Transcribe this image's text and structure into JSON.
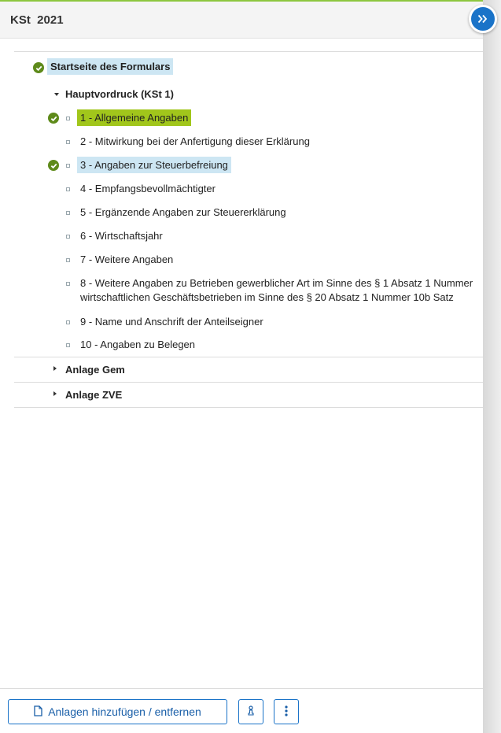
{
  "header": {
    "title": "KSt  2021"
  },
  "tree": {
    "root": {
      "label": "Startseite des Formulars",
      "done": true
    },
    "groups": [
      {
        "label": "Hauptvordruck (KSt 1)",
        "expanded": true,
        "items": [
          {
            "label": "1 - Allgemeine Angaben",
            "done": true,
            "highlight": "active"
          },
          {
            "label": "2 - Mitwirkung bei der Anfertigung dieser Erklärung",
            "done": false
          },
          {
            "label": "3 - Angaben zur Steuerbefreiung",
            "done": true,
            "highlight": "selected"
          },
          {
            "label": "4 - Empfangsbevollmächtigter",
            "done": false
          },
          {
            "label": "5 - Ergänzende Angaben zur Steuererklärung",
            "done": false
          },
          {
            "label": "6 - Wirtschaftsjahr",
            "done": false
          },
          {
            "label": "7 - Weitere Angaben",
            "done": false
          },
          {
            "label_line1": "8 - Weitere Angaben zu Betrieben gewerblicher Art im Sinne des § 1 Absatz 1 Nummer",
            "label_line2": "wirtschaftlichen Geschäftsbetrieben im Sinne des § 20 Absatz 1 Nummer 10b Satz",
            "done": false
          },
          {
            "label": "9 - Name und Anschrift der Anteilseigner",
            "done": false
          },
          {
            "label": "10 - Angaben zu Belegen",
            "done": false
          }
        ]
      },
      {
        "label": "Anlage Gem",
        "expanded": false
      },
      {
        "label": "Anlage ZVE",
        "expanded": false
      }
    ]
  },
  "footer": {
    "add_remove_label": "Anlagen hinzufügen / entfernen",
    "add_remove_icon": "document-icon",
    "person_icon": "person-icon",
    "more_icon": "more-vertical-icon"
  },
  "colors": {
    "accent": "#1a73c8",
    "done": "#5e8a1a",
    "active_bg": "#a1c61b",
    "selected_bg": "#cde6f3"
  }
}
